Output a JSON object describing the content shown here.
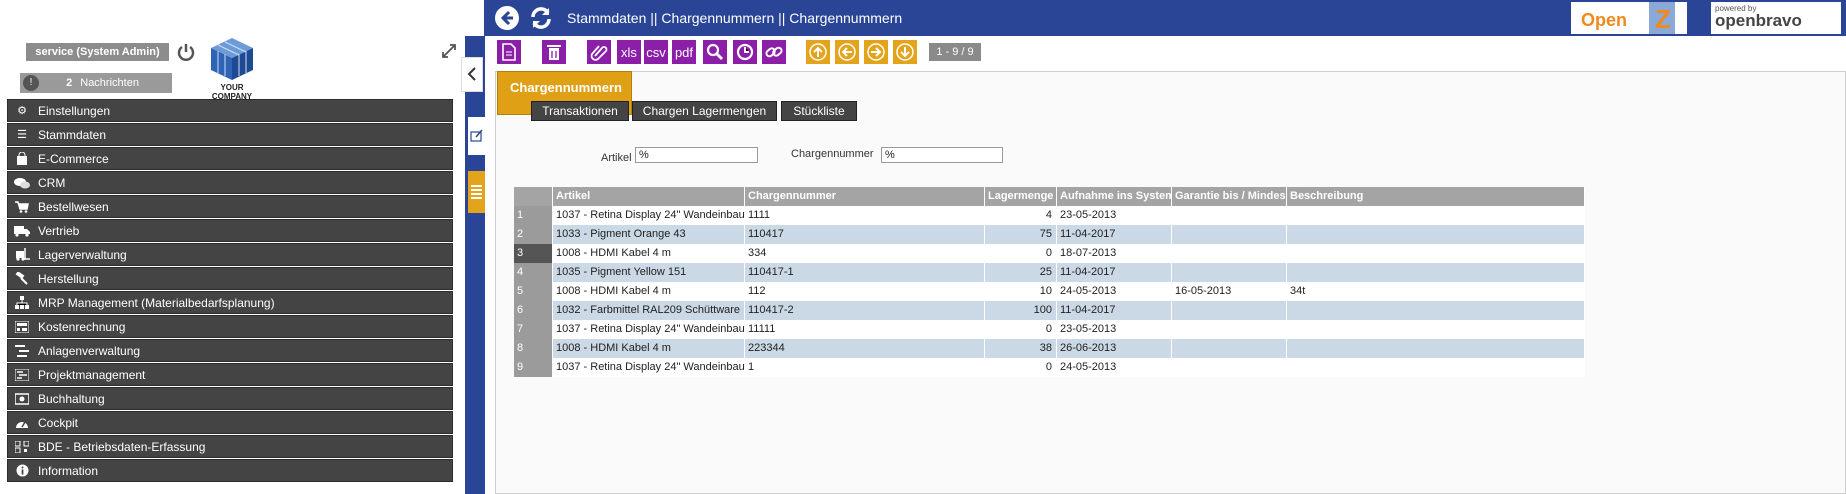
{
  "header": {
    "breadcrumb": "Stammdaten || Chargennummern  ||  Chargennummern",
    "back_icon": "back-arrow-icon",
    "refresh_icon": "refresh-icon",
    "openz_logo": "OpenZ",
    "openbravo_powered": "powered by",
    "openbravo_logo": "openbravo"
  },
  "sidebar": {
    "user_label": "service (System Admin)",
    "messages_count": "2",
    "messages_label": "Nachrichten",
    "company_label": "YOUR COMPANY",
    "menu": [
      {
        "label": "Einstellungen",
        "icon": "gear-icon"
      },
      {
        "label": "Stammdaten",
        "icon": "list-icon"
      },
      {
        "label": "E-Commerce",
        "icon": "bag-icon"
      },
      {
        "label": "CRM",
        "icon": "chat-icon"
      },
      {
        "label": "Bestellwesen",
        "icon": "cart-icon"
      },
      {
        "label": "Vertrieb",
        "icon": "truck-icon"
      },
      {
        "label": "Lagerverwaltung",
        "icon": "forklift-icon"
      },
      {
        "label": "Herstellung",
        "icon": "hammer-icon"
      },
      {
        "label": "MRP Management (Materialbedarfsplanung)",
        "icon": "hierarchy-icon"
      },
      {
        "label": "Kostenrechnung",
        "icon": "calculator-icon"
      },
      {
        "label": "Anlagenverwaltung",
        "icon": "tasks-icon"
      },
      {
        "label": "Projektmanagement",
        "icon": "project-icon"
      },
      {
        "label": "Buchhaltung",
        "icon": "money-icon"
      },
      {
        "label": "Cockpit",
        "icon": "dashboard-icon"
      },
      {
        "label": "BDE - Betriebsdaten-Erfassung",
        "icon": "barcode-icon"
      },
      {
        "label": "Information",
        "icon": "info-icon"
      }
    ]
  },
  "toolbar": {
    "buttons": [
      "new-document-icon",
      "delete-icon",
      "attachment-icon",
      "xls",
      "csv",
      "pdf",
      "search-icon",
      "history-icon",
      "link-icon"
    ],
    "paging": "1 - 9 / 9"
  },
  "tabs": {
    "main": "Chargennummern",
    "sub": [
      "Transaktionen",
      "Chargen Lagermengen",
      "Stückliste"
    ]
  },
  "filter": {
    "artikel_label": "Artikel",
    "artikel_value": "%",
    "charge_label": "Chargennummer",
    "charge_value": "%"
  },
  "table": {
    "columns": [
      "",
      "Artikel",
      "Chargennummer",
      "Lagermenge",
      "Aufnahme ins System",
      "Garantie bis / Mindes",
      "Beschreibung"
    ],
    "rows": [
      [
        "1",
        "1037 - Retina Display 24\" Wandeinbau",
        "1111",
        "4",
        "23-05-2013",
        "",
        ""
      ],
      [
        "2",
        "1033 - Pigment Orange 43",
        "110417",
        "75",
        "11-04-2017",
        "",
        ""
      ],
      [
        "3",
        "1008 - HDMI Kabel 4 m",
        "334",
        "0",
        "18-07-2013",
        "",
        ""
      ],
      [
        "4",
        "1035 - Pigment Yellow 151",
        "110417-1",
        "25",
        "11-04-2017",
        "",
        ""
      ],
      [
        "5",
        "1008 - HDMI Kabel 4 m",
        "112",
        "10",
        "24-05-2013",
        "16-05-2013",
        "34t"
      ],
      [
        "6",
        "1032 - Farbmittel RAL209 Schüttware",
        "110417-2",
        "100",
        "11-04-2017",
        "",
        ""
      ],
      [
        "7",
        "1037 - Retina Display 24\" Wandeinbau",
        "11111",
        "0",
        "23-05-2013",
        "",
        ""
      ],
      [
        "8",
        "1008 - HDMI Kabel 4 m",
        "223344",
        "38",
        "26-06-2013",
        "",
        ""
      ],
      [
        "9",
        "1037 - Retina Display 24\" Wandeinbau",
        "1",
        "0",
        "24-05-2013",
        "",
        ""
      ]
    ]
  },
  "colors": {
    "header_blue": "#2a4595",
    "toolbar_purple": "#8b1fa8",
    "nav_orange": "#e3a31a",
    "row_alt": "#cbd8e5"
  }
}
